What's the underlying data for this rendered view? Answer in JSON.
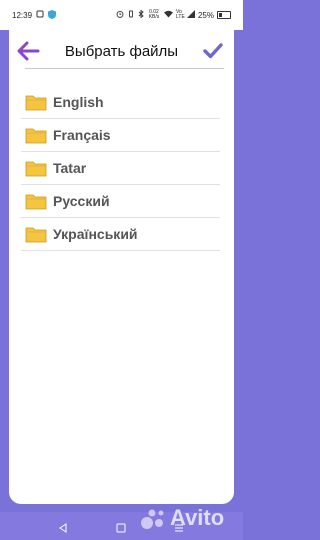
{
  "status_bar": {
    "time": "12:39",
    "network_speed": "0.02 KB/s",
    "signal_label": "Vo LTE",
    "battery_percent": "25%",
    "battery_level": 0.25
  },
  "header": {
    "title": "Выбрать файлы"
  },
  "files": [
    {
      "label": "English"
    },
    {
      "label": "Français"
    },
    {
      "label": "Tatar"
    },
    {
      "label": "Русский"
    },
    {
      "label": "Український"
    }
  ],
  "colors": {
    "accent": "#8e44c8",
    "check": "#6f66d6",
    "background": "#7a72d9",
    "folder": "#f5c542"
  },
  "watermark": "Avito"
}
